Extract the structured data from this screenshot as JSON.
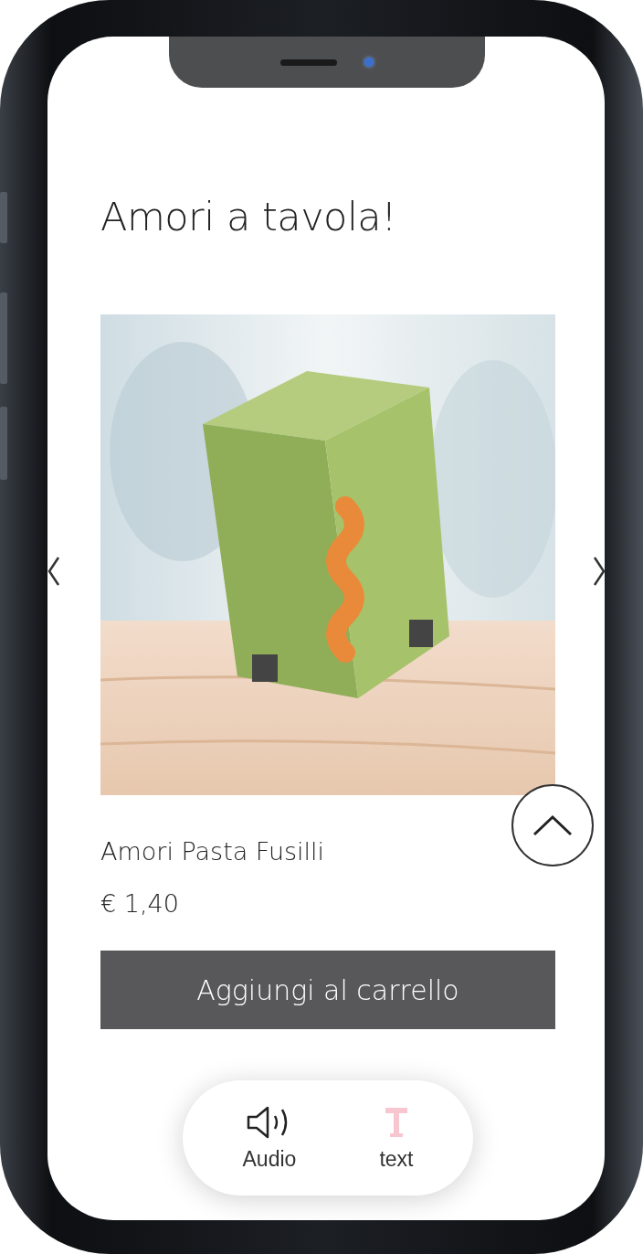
{
  "page": {
    "title": "Amori a tavola!"
  },
  "product": {
    "name": "Amori Pasta Fusilli",
    "price": "€ 1,40",
    "add_button": "Aggiungi al carrello"
  },
  "accessibility_bar": [
    {
      "kind": "audio",
      "label": "Audio"
    },
    {
      "kind": "text",
      "label": "text"
    }
  ]
}
